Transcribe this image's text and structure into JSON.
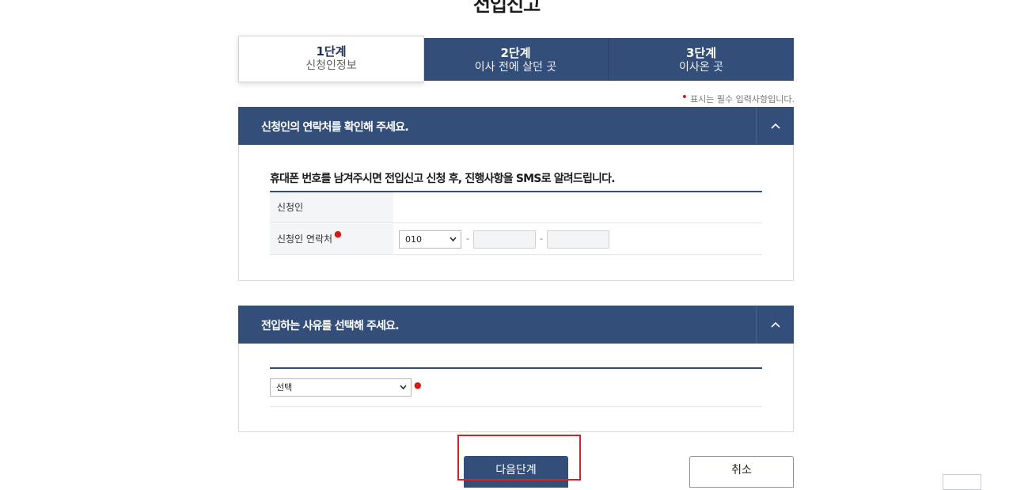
{
  "page": {
    "title": "전입신고",
    "required_note": "표시는 필수 입력사항입니다."
  },
  "steps": [
    {
      "num": "1단계",
      "desc": "신청인정보",
      "active": true
    },
    {
      "num": "2단계",
      "desc": "이사 전에 살던 곳",
      "active": false
    },
    {
      "num": "3단계",
      "desc": "이사온 곳",
      "active": false
    }
  ],
  "contact_section": {
    "title": "신청인의 연락처를 확인해 주세요.",
    "subtitle": "휴대폰 번호를 남겨주시면 전입신고 신청 후, 진행사항을 SMS로 알려드립니다.",
    "applicant_label": "신청인",
    "applicant_value": "",
    "phone_label": "신청인 연락처",
    "phone_prefix": "010",
    "phone_middle": "",
    "phone_last": "",
    "separator": "-"
  },
  "reason_section": {
    "title": "전입하는 사유를 선택해 주세요.",
    "reason_select_value": "선택"
  },
  "buttons": {
    "next": "다음단계",
    "cancel": "취소"
  },
  "colors": {
    "primary": "#344e7a",
    "required": "#d21b1b",
    "highlight": "#d1232a"
  }
}
